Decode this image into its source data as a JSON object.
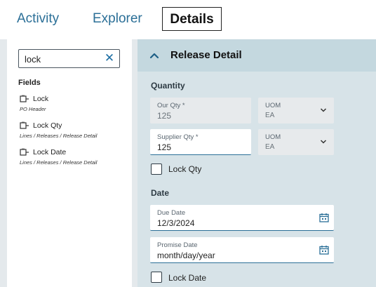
{
  "tabs": [
    {
      "label": "Activity"
    },
    {
      "label": "Explorer"
    },
    {
      "label": "Details"
    }
  ],
  "search": {
    "value": "lock",
    "clear_icon": "✕"
  },
  "fields_panel": {
    "heading": "Fields",
    "items": [
      {
        "label": "Lock",
        "path": "PO Header",
        "icon": "field-link-icon"
      },
      {
        "label": "Lock Qty",
        "path": "Lines / Releases / Release Detail",
        "icon": "field-link-icon"
      },
      {
        "label": "Lock Date",
        "path": "Lines / Releases / Release Detail",
        "icon": "field-link-icon"
      }
    ]
  },
  "section": {
    "title": "Release Detail",
    "toggle_icon": "chevron-up-icon"
  },
  "quantity": {
    "heading": "Quantity",
    "our_qty": {
      "label": "Our Qty *",
      "value": "125"
    },
    "our_uom": {
      "label": "UOM",
      "value": "EA"
    },
    "supplier_qty": {
      "label": "Supplier Qty *",
      "value": "125"
    },
    "supplier_uom": {
      "label": "UOM",
      "value": "EA"
    },
    "lock_qty": {
      "label": "Lock Qty",
      "checked": false
    }
  },
  "date": {
    "heading": "Date",
    "due_date": {
      "label": "Due Date",
      "value": "12/3/2024"
    },
    "promise_date": {
      "label": "Promise Date",
      "placeholder": "month/day/year"
    },
    "lock_date": {
      "label": "Lock Date",
      "checked": false
    }
  },
  "colors": {
    "accent": "#2b6f97",
    "right_bg": "#d7e3e8",
    "header_bg": "#c4d8df",
    "left_bg": "#e4e9ec"
  }
}
